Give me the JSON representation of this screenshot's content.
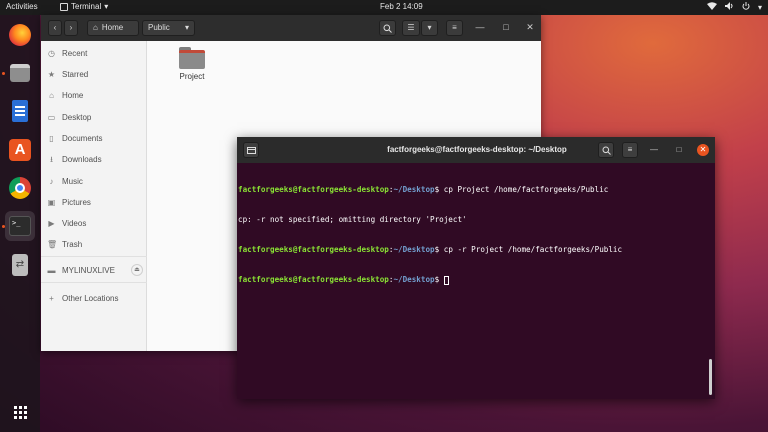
{
  "topbar": {
    "activities": "Activities",
    "app_menu": "Terminal",
    "clock": "Feb 2  14:09"
  },
  "dock": {
    "items": [
      {
        "name": "firefox",
        "active": false
      },
      {
        "name": "files",
        "active": false
      },
      {
        "name": "libreoffice-writer",
        "active": false
      },
      {
        "name": "ubuntu-software",
        "active": false
      },
      {
        "name": "chrome",
        "active": false
      },
      {
        "name": "terminal",
        "active": true
      },
      {
        "name": "usb-drive",
        "active": false
      }
    ],
    "accent_color": "#e95420"
  },
  "files": {
    "path": {
      "home": "Home",
      "current": "Public"
    },
    "sidebar": [
      {
        "label": "Recent",
        "icon": "clock-icon"
      },
      {
        "label": "Starred",
        "icon": "star-icon"
      },
      {
        "label": "Home",
        "icon": "home-icon"
      },
      {
        "label": "Desktop",
        "icon": "desktop-icon"
      },
      {
        "label": "Documents",
        "icon": "document-icon"
      },
      {
        "label": "Downloads",
        "icon": "download-icon"
      },
      {
        "label": "Music",
        "icon": "music-icon"
      },
      {
        "label": "Pictures",
        "icon": "pictures-icon"
      },
      {
        "label": "Videos",
        "icon": "videos-icon"
      },
      {
        "label": "Trash",
        "icon": "trash-icon"
      },
      {
        "label": "MYLINUXLIVE",
        "icon": "drive-icon"
      },
      {
        "label": "Other Locations",
        "icon": "plus-icon"
      }
    ],
    "items": [
      {
        "label": "Project",
        "icon": "folder-icon"
      }
    ]
  },
  "terminal": {
    "title": "factforgeeks@factforgeeks-desktop: ~/Desktop",
    "lines": [
      {
        "user": "factforgeeks@factforgeeks-desktop",
        "sep": ":",
        "path": "~/Desktop",
        "cmd": "$ cp Project /home/factforgeeks/Public"
      },
      {
        "text": "cp: -r not specified; omitting directory 'Project'"
      },
      {
        "user": "factforgeeks@factforgeeks-desktop",
        "sep": ":",
        "path": "~/Desktop",
        "cmd": "$ cp -r Project /home/factforgeeks/Public"
      },
      {
        "user": "factforgeeks@factforgeeks-desktop",
        "sep": ":",
        "path": "~/Desktop",
        "cmd": "$ "
      }
    ],
    "colors": {
      "background": "#300a24",
      "user": "#8ae234",
      "path": "#729fcf"
    }
  }
}
